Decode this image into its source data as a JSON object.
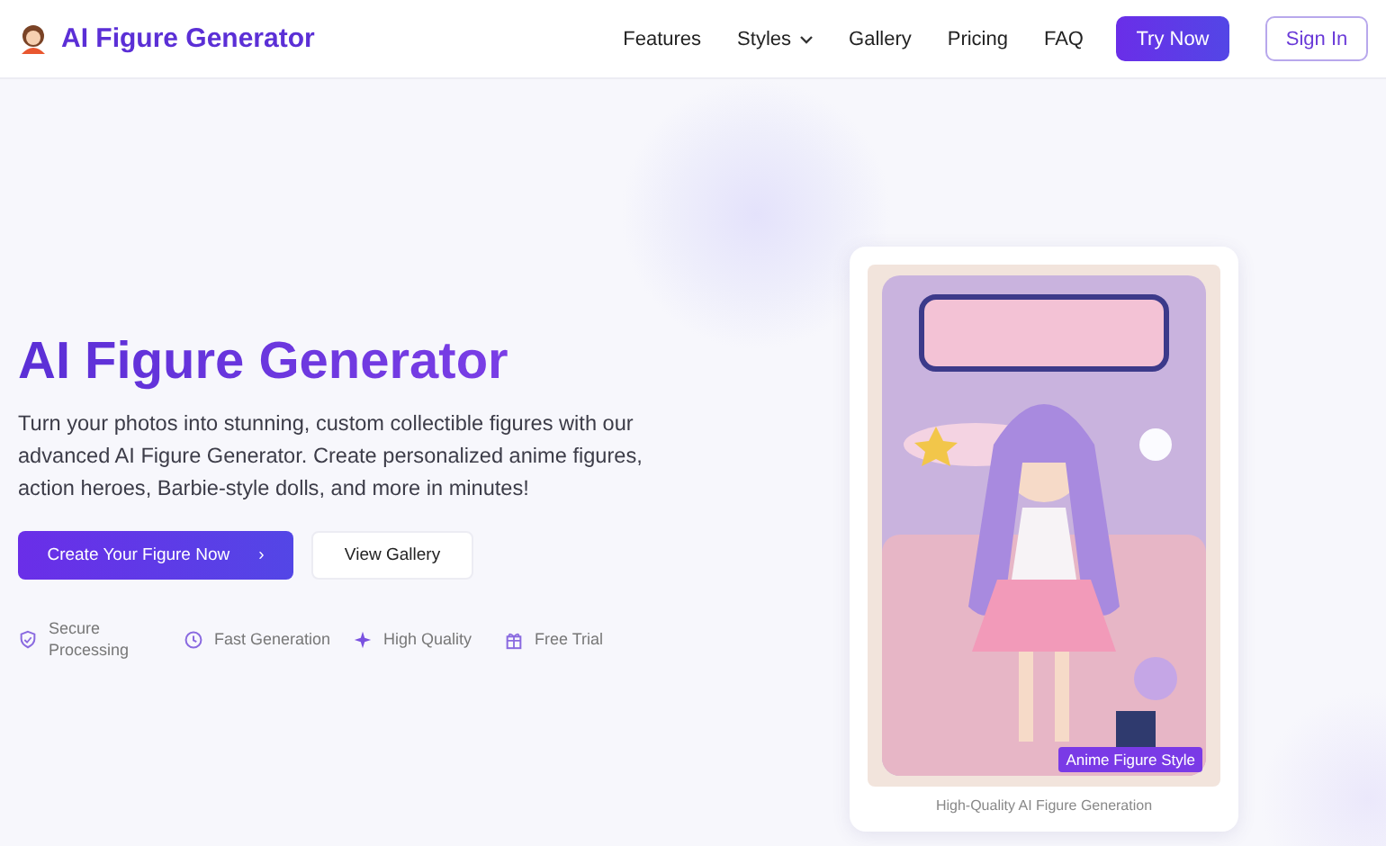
{
  "header": {
    "logo_text": "AI Figure Generator",
    "nav": [
      {
        "label": "Features",
        "has_menu": false
      },
      {
        "label": "Styles",
        "has_menu": true
      },
      {
        "label": "Gallery",
        "has_menu": false
      },
      {
        "label": "Pricing",
        "has_menu": false
      },
      {
        "label": "FAQ",
        "has_menu": false
      }
    ],
    "buttons": [
      {
        "label": "Try Now",
        "kind": "primary"
      },
      {
        "label": "Sign In",
        "kind": "outline"
      }
    ]
  },
  "hero": {
    "title": "AI Figure Generator",
    "description": "Turn your photos into stunning, custom collectible figures with our advanced AI Figure Generator. Create personalized anime figures, action heroes, Barbie-style dolls, and more in minutes!",
    "buttons": [
      {
        "label": "Create Your Figure Now",
        "kind": "primary",
        "arrow": "›"
      },
      {
        "label": "View Gallery",
        "kind": "secondary"
      }
    ],
    "features": [
      {
        "label": "Secure Processing",
        "kind": "shield"
      },
      {
        "label": "Fast Generation",
        "kind": "clock"
      },
      {
        "label": "High Quality",
        "kind": "sparkle"
      },
      {
        "label": "Free Trial",
        "kind": "gift"
      }
    ]
  },
  "preview": {
    "kind": "picture",
    "badge": "Anime Figure Style",
    "caption": "High-Quality AI Figure Generation"
  }
}
